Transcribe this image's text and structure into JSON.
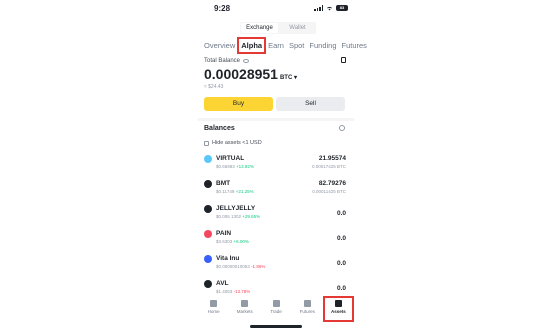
{
  "status_bar": {
    "time": "9:28",
    "battery": "83"
  },
  "segment": {
    "exchange": "Exchange",
    "wallet": "Wallet"
  },
  "tabs": [
    "Overview",
    "Alpha",
    "Earn",
    "Spot",
    "Funding",
    "Futures"
  ],
  "balance": {
    "label": "Total Balance",
    "value": "0.00028951",
    "currency": "BTC",
    "usd": "≈ $24.43"
  },
  "actions": {
    "buy": "Buy",
    "sell": "Sell"
  },
  "balances_title": "Balances",
  "hide_small": "Hide assets <1 USD",
  "assets": [
    {
      "name": "VIRTUAL",
      "price": "$0.66983",
      "change": "+13.92%",
      "dir": "up",
      "amount": "21.95574",
      "btc": "0.00017425 BTC",
      "color": "#5ac8fa"
    },
    {
      "name": "BMT",
      "price": "$0.11749",
      "change": "+21.25%",
      "dir": "up",
      "amount": "82.79276",
      "btc": "0.00011425 BTC",
      "color": "#1e2329"
    },
    {
      "name": "JELLYJELLY",
      "price": "$0.006 1302",
      "change": "+29.65%",
      "dir": "up",
      "amount": "0.0",
      "btc": "",
      "color": "#1e2329"
    },
    {
      "name": "PAIN",
      "price": "$3.6303",
      "change": "+6.00%",
      "dir": "up",
      "amount": "0.0",
      "btc": "",
      "color": "#f6465d"
    },
    {
      "name": "Vita Inu",
      "price": "$0.00000010053",
      "change": "-1.86%",
      "dir": "down",
      "amount": "0.0",
      "btc": "",
      "color": "#3861fb"
    },
    {
      "name": "AVL",
      "price": "$1.4063",
      "change": "-13.78%",
      "dir": "down",
      "amount": "0.0",
      "btc": "",
      "color": "#1e2329"
    }
  ],
  "nav": [
    "Home",
    "Markets",
    "Trade",
    "Futures",
    "Assets"
  ]
}
